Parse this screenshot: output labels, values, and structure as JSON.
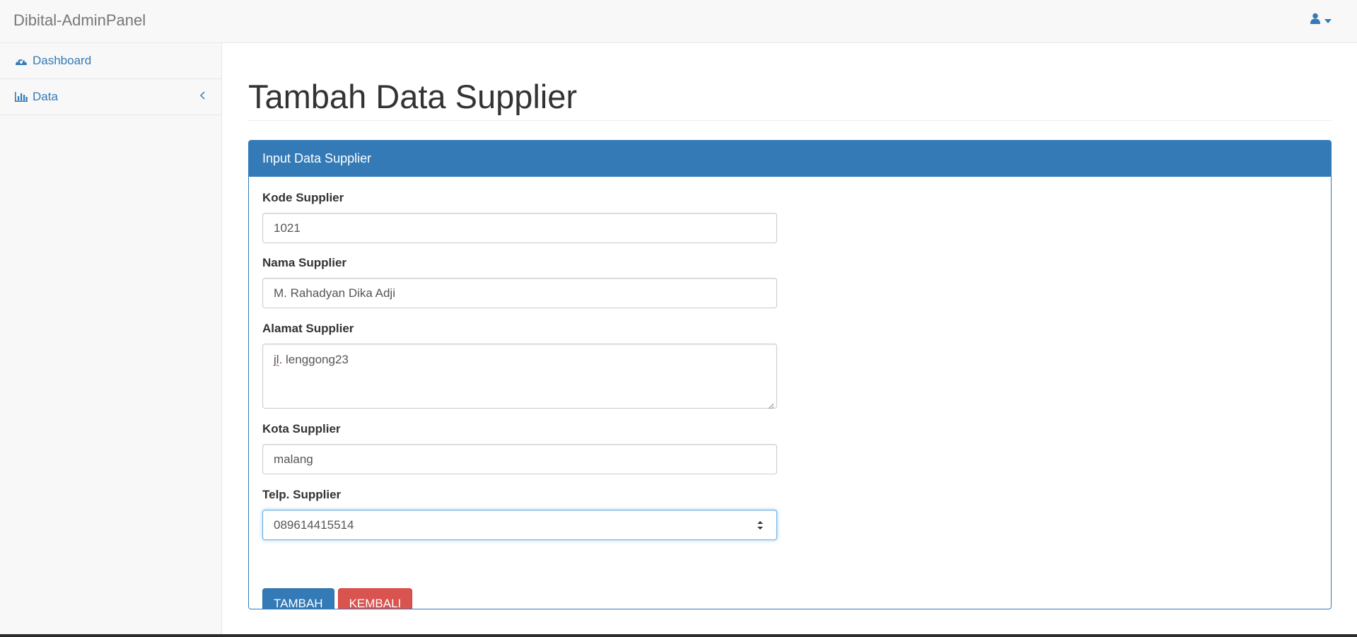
{
  "app": {
    "brand": "Dibital-AdminPanel"
  },
  "header": {
    "user_icon": "user-icon",
    "caret_icon": "caret-down-icon"
  },
  "sidebar": {
    "items": [
      {
        "label": "Dashboard",
        "icon": "tachometer-icon"
      },
      {
        "label": "Data",
        "icon": "bar-chart-icon",
        "chevron": "chevron-left-icon"
      }
    ]
  },
  "page": {
    "title": "Tambah Data Supplier"
  },
  "panel": {
    "heading": "Input Data Supplier"
  },
  "form": {
    "kode": {
      "label": "Kode Supplier",
      "value": "1021"
    },
    "nama": {
      "label": "Nama Supplier",
      "value": "M. Rahadyan Dika Adji"
    },
    "alamat": {
      "label": "Alamat Supplier",
      "value_underlined": "jl",
      "value_rest": ". lenggong23"
    },
    "kota": {
      "label": "Kota Supplier",
      "value": "malang"
    },
    "telp": {
      "label": "Telp. Supplier",
      "value": "089614415514"
    }
  },
  "buttons": {
    "tambah": "TAMBAH",
    "kembali": "KEMBALI"
  },
  "colors": {
    "primary": "#337ab7",
    "danger": "#d9534f",
    "link": "#337ab7"
  }
}
